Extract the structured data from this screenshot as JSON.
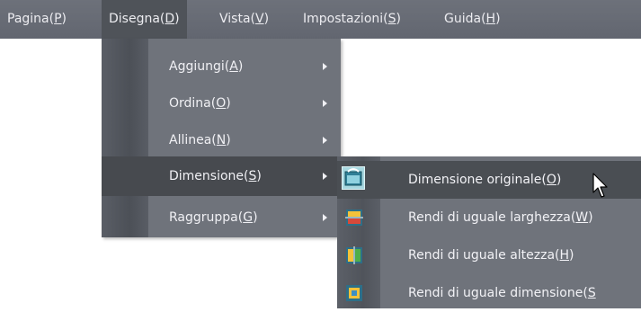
{
  "menubar": {
    "items": [
      {
        "text": "Pagina(",
        "key": "P",
        "close": ")"
      },
      {
        "text": "Disegna(",
        "key": "D",
        "close": ")"
      },
      {
        "text": "Vista(",
        "key": "V",
        "close": ")"
      },
      {
        "text": "Impostazioni(",
        "key": "S",
        "close": ")"
      },
      {
        "text": "Guida(",
        "key": "H",
        "close": ")"
      }
    ],
    "active_index": 1
  },
  "disegna_menu": {
    "items": [
      {
        "text": "Aggiungi(",
        "key": "A",
        "close": ")",
        "submenu": true
      },
      {
        "text": "Ordina(",
        "key": "O",
        "close": ")",
        "submenu": true
      },
      {
        "text": "Allinea(",
        "key": "N",
        "close": ")",
        "submenu": true
      },
      {
        "text": "Dimensione(",
        "key": "S",
        "close": ")",
        "submenu": true
      },
      {
        "text": "Raggruppa(",
        "key": "G",
        "close": ")",
        "submenu": true
      }
    ],
    "selected_index": 3
  },
  "dimensione_submenu": {
    "items": [
      {
        "text": "Dimensione originale(",
        "key": "O",
        "close": ")",
        "icon": "original-size-icon"
      },
      {
        "text": "Rendi di uguale larghezza(",
        "key": "W",
        "close": ")",
        "icon": "same-width-icon"
      },
      {
        "text": "Rendi di uguale altezza(",
        "key": "H",
        "close": ")",
        "icon": "same-height-icon"
      },
      {
        "text": "Rendi di uguale dimensione(",
        "key": "S",
        "close": "",
        "icon": "same-size-icon"
      }
    ],
    "hover_index": 0
  },
  "colors": {
    "menubar_bg": "#676b74",
    "menu_bg": "#6f737b",
    "selected_bg": "#474a4f",
    "text": "#f0f0f4"
  }
}
